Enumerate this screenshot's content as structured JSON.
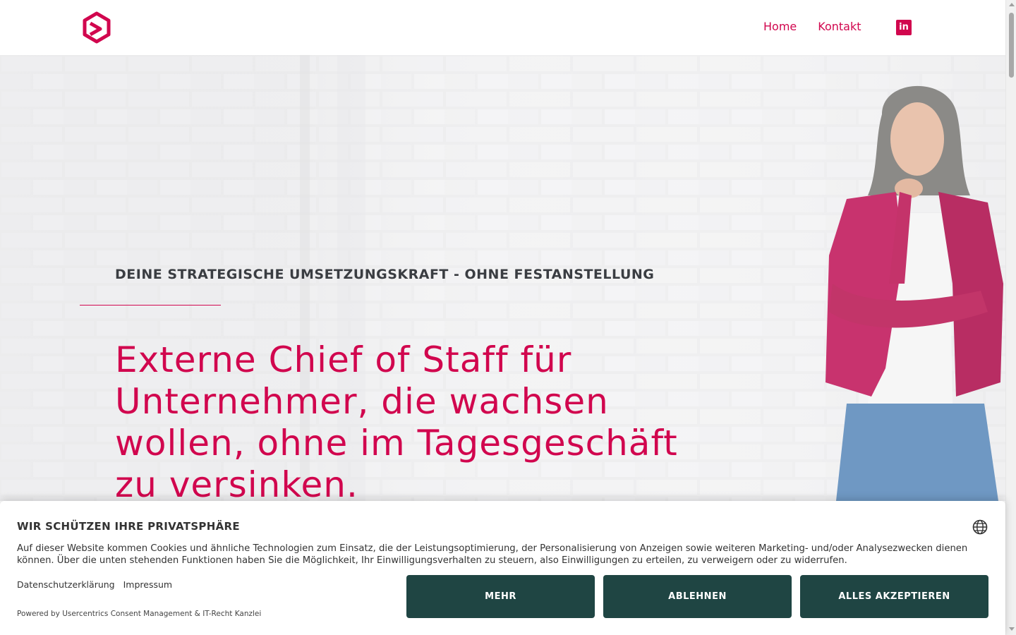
{
  "header": {
    "nav": [
      {
        "label": "Home"
      },
      {
        "label": "Kontakt"
      }
    ],
    "linkedin_icon": "linkedin-icon",
    "brand_color": "#d1064e"
  },
  "hero": {
    "kicker": "DEINE STRATEGISCHE UMSETZUNGSKRAFT - OHNE FESTANSTELLUNG",
    "headline": "Externe Chief of Staff für Unternehmer, die wachsen wollen, ohne im Tagesgeschäft zu versinken."
  },
  "cookie_banner": {
    "title": "WIR SCHÜTZEN IHRE PRIVATSPHÄRE",
    "text": "Auf dieser Website kommen Cookies und ähnliche Technologien zum Einsatz, die der Leistungsoptimierung, der Personalisierung von Anzeigen sowie weiteren Marketing- und/oder Analysezwecken dienen können. Über die unten stehenden Funktionen haben Sie die Möglichkeit, Ihr Einwilligungsverhalten zu steuern, also Einwilligungen zu erteilen, zu verweigern oder zu widerrufen.",
    "links": [
      {
        "label": "Datenschutzerklärung"
      },
      {
        "label": "Impressum"
      }
    ],
    "powered_by": "Powered by Usercentrics Consent Management & IT-Recht Kanzlei",
    "buttons": {
      "more": "MEHR",
      "deny": "ABLEHNEN",
      "accept": "ALLES AKZEPTIEREN"
    },
    "button_color": "#1f4543",
    "language_icon": "globe-icon"
  }
}
